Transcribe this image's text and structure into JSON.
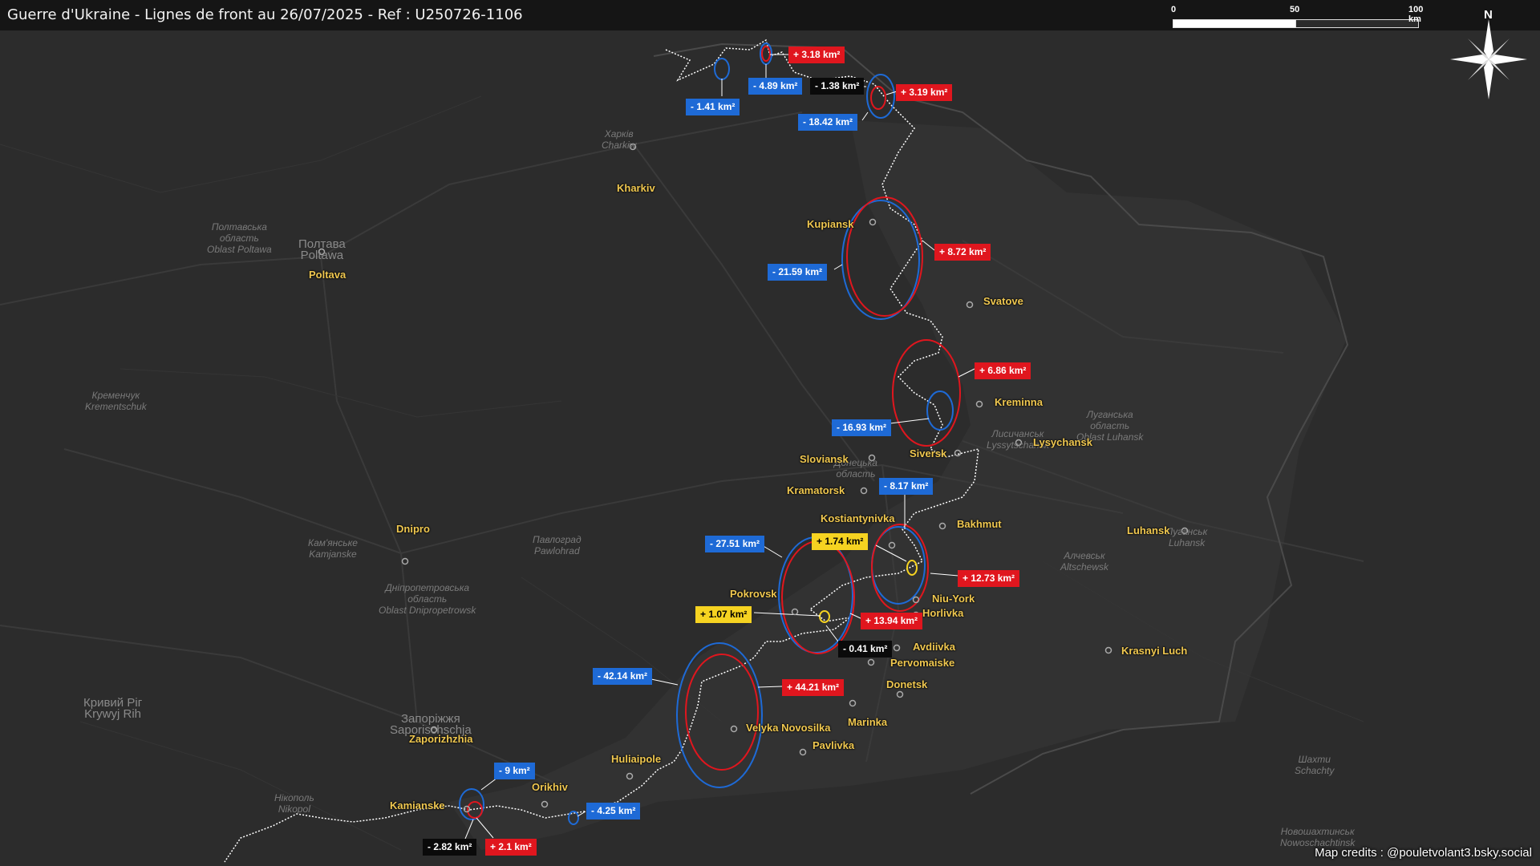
{
  "title": "Guerre d'Ukraine - Lignes de front au 26/07/2025 - Ref : U250726-1106",
  "scale": {
    "ticks": [
      "0",
      "50",
      "100 km"
    ]
  },
  "north_label": "N",
  "credits": "Map credits : @pouletvolant3.bsky.social",
  "colors": {
    "gain": "#e0161e",
    "loss": "#1e6ad6",
    "neutral": "#0a0a0a",
    "small": "#f6d321",
    "city": "#f0c850",
    "front": "#ffffff"
  },
  "cities": [
    "Kharkiv",
    "Poltava",
    "Kupiansk",
    "Svatove",
    "Kreminna",
    "Siversk",
    "Lysychansk",
    "Sloviansk",
    "Kramatorsk",
    "Kostiantynivka",
    "Bakhmut",
    "Luhansk",
    "Dnipro",
    "Pokrovsk",
    "Niu-York",
    "Horlivka",
    "Avdiivka",
    "Pervomaiske",
    "Donetsk",
    "Marinka",
    "Krasnyi Luch",
    "Velyka Novosilka",
    "Pavlivka",
    "Huliaipole",
    "Orikhiv",
    "Kamianske",
    "Zaporizhzhia"
  ],
  "basemap_labels": [
    "Харків\nCharkiw",
    "Полтавська\nобласть\nOblast Poltawa",
    "Полтава\nPoltawa",
    "Кременчук\nKrementschuk",
    "Луганська\nобласть\nOblast Luhansk",
    "Лисичанськ\nLyssytschansk",
    "Луганськ\nLuhansk",
    "Алчевськ\nAltschewsk",
    "Павлоград\nPawlohrad",
    "Кам'янське\nKamjanske",
    "Дніпропетровська\nобласть\nOblast Dnipropetrowsk",
    "Кривий Ріг\nKrywyj Rih",
    "Запоріжжя\nSaporischschja",
    "Нікополь\nNikopol",
    "Шахти\nSchachty",
    "Новошахтинськ\nNowoschachtinsk",
    "Донецька\nобласть"
  ],
  "changes": [
    {
      "label": "+ 3.18 km²",
      "type": "gain"
    },
    {
      "label": "- 4.89 km²",
      "type": "loss"
    },
    {
      "label": "- 1.41 km²",
      "type": "loss"
    },
    {
      "label": "- 1.38 km²",
      "type": "neutral"
    },
    {
      "label": "+ 3.19 km²",
      "type": "gain"
    },
    {
      "label": "- 18.42 km²",
      "type": "loss"
    },
    {
      "label": "+ 8.72 km²",
      "type": "gain"
    },
    {
      "label": "- 21.59 km²",
      "type": "loss"
    },
    {
      "label": "+ 6.86 km²",
      "type": "gain"
    },
    {
      "label": "- 16.93 km²",
      "type": "loss"
    },
    {
      "label": "- 8.17 km²",
      "type": "loss"
    },
    {
      "label": "+ 1.74 km²",
      "type": "small"
    },
    {
      "label": "- 27.51 km²",
      "type": "loss"
    },
    {
      "label": "+ 12.73 km²",
      "type": "gain"
    },
    {
      "label": "+ 1.07 km²",
      "type": "small"
    },
    {
      "label": "+ 13.94 km²",
      "type": "gain"
    },
    {
      "label": "- 0.41 km²",
      "type": "neutral"
    },
    {
      "label": "- 42.14 km²",
      "type": "loss"
    },
    {
      "label": "+ 44.21 km²",
      "type": "gain"
    },
    {
      "label": "- 9 km²",
      "type": "loss"
    },
    {
      "label": "- 4.25 km²",
      "type": "loss"
    },
    {
      "label": "- 2.82 km²",
      "type": "neutral"
    },
    {
      "label": "+ 2.1 km²",
      "type": "gain"
    }
  ]
}
